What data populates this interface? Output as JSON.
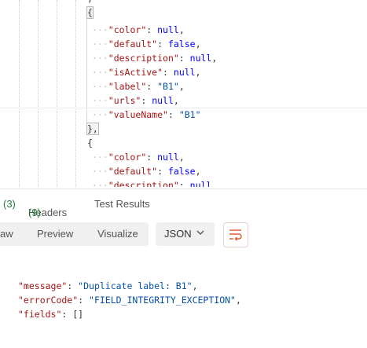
{
  "request_body": {
    "line_top": ",",
    "obj1": {
      "color": "null",
      "default": "false",
      "description": "null",
      "isActive": "null",
      "label": "\"B1\"",
      "urls": "null",
      "valueName": "\"B1\""
    },
    "line_close": "},",
    "line_open": "{",
    "obj2": {
      "color": "null",
      "default": "false",
      "description": "null"
    },
    "keys": {
      "color": "\"color\"",
      "default": "\"default\"",
      "description": "\"description\"",
      "isActive": "\"isActive\"",
      "label": "\"label\"",
      "urls": "\"urls\"",
      "valueName": "\"valueName\""
    }
  },
  "response_tabs": {
    "partial_count": "(3)",
    "headers_label": "Headers",
    "headers_count": "(9)",
    "test_results": "Test Results"
  },
  "view_modes": {
    "raw": "aw",
    "preview": "Preview",
    "visualize": "Visualize"
  },
  "format": {
    "label": "JSON",
    "icon": "chevron-down-icon"
  },
  "wrap_icon": "wrap-lines-icon",
  "response_body": {
    "message_key": "\"message\"",
    "message_value": "\"Duplicate label: B1\"",
    "errorCode_key": "\"errorCode\"",
    "errorCode_value": "\"FIELD_INTEGRITY_EXCEPTION\"",
    "fields_key": "\"fields\"",
    "fields_value": "[]"
  },
  "colors": {
    "key": "#a31515",
    "string": "#0451a5",
    "keyword": "#0000ff",
    "count": "#1e7d3b",
    "accent": "#e05a2b"
  }
}
